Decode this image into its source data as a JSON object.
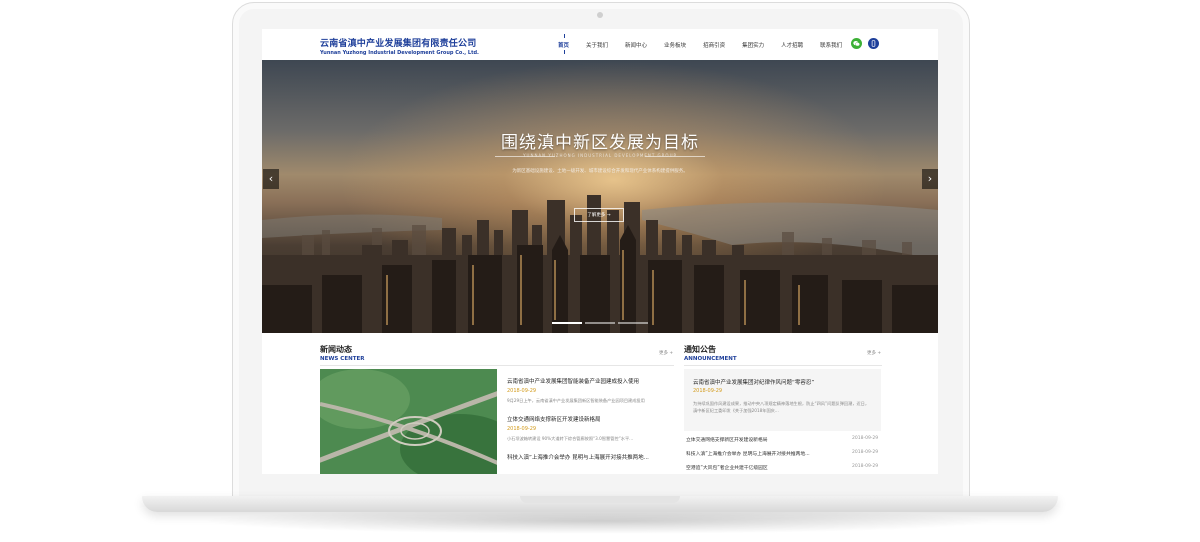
{
  "site": {
    "name_cn": "云南省滇中产业发展集团有限责任公司",
    "name_en": "Yunnan Yuzhong Industrial Development Group Co., Ltd."
  },
  "nav": {
    "items": [
      {
        "label": "首页",
        "active": true
      },
      {
        "label": "关于我们"
      },
      {
        "label": "新闻中心"
      },
      {
        "label": "业务板块"
      },
      {
        "label": "招商引资"
      },
      {
        "label": "集团实力"
      },
      {
        "label": "人才招聘"
      },
      {
        "label": "联系我们"
      }
    ]
  },
  "social": {
    "wechat_icon": "wechat-icon",
    "phone_icon": "phone-icon"
  },
  "hero": {
    "title": "围绕滇中新区发展为目标",
    "subtitle": "YUNNAN YUZHONG INDUSTRIAL DEVELOPMENT GROUP",
    "desc": "为新区基础设施建设、土地一级开发、城市建设综合开发和现代产业体系构建提供服务。",
    "button": "了解更多 →",
    "prev": "‹",
    "next": "›",
    "slide_count": 3,
    "active_slide": 0
  },
  "news": {
    "title": "新闻动态",
    "subtitle": "NEWS CENTER",
    "more": "更多 +",
    "items": [
      {
        "title": "云南省滇中产业发展集团智能装备产业园建成投入使用",
        "date": "2018-09-29",
        "desc": "9月29日上午，云南省滇中产业发展集团新区智能装备产业园项目建成投用"
      },
      {
        "title": "立体交通网络支撑新区开发建设新格局",
        "date": "2018-09-29",
        "desc": "小石坝波箱转建设 90%大道转下综合管廊按照“3.0智慧管控”水平..."
      },
      {
        "title": "科技入滇”上海推介会举办 昆明与上海展开对接共推两地..."
      }
    ]
  },
  "announcement": {
    "title": "通知公告",
    "subtitle": "ANNOUNCEMENT",
    "more": "更多 +",
    "featured": {
      "title": "云南省滇中产业发展集团对纪律作风问题“零容忍”",
      "date": "2018-09-29",
      "desc": "为持续巩固作风建设成果，推动中央八项规定精神落地生根，防止“四风”问题反弹回潮，近日，滇中新区纪工委印发《关于加强2018年国庆..."
    },
    "items": [
      {
        "title": "立体交通网络支撑新区开发建设新格局",
        "date": "2018-09-29"
      },
      {
        "title": "科技入滇”上海推介会举办 昆明与上海展开对接共推两地...",
        "date": "2018-09-29"
      },
      {
        "title": "空港追“大风包”者企业共建千亿级园区",
        "date": "2018-09-29"
      }
    ]
  }
}
